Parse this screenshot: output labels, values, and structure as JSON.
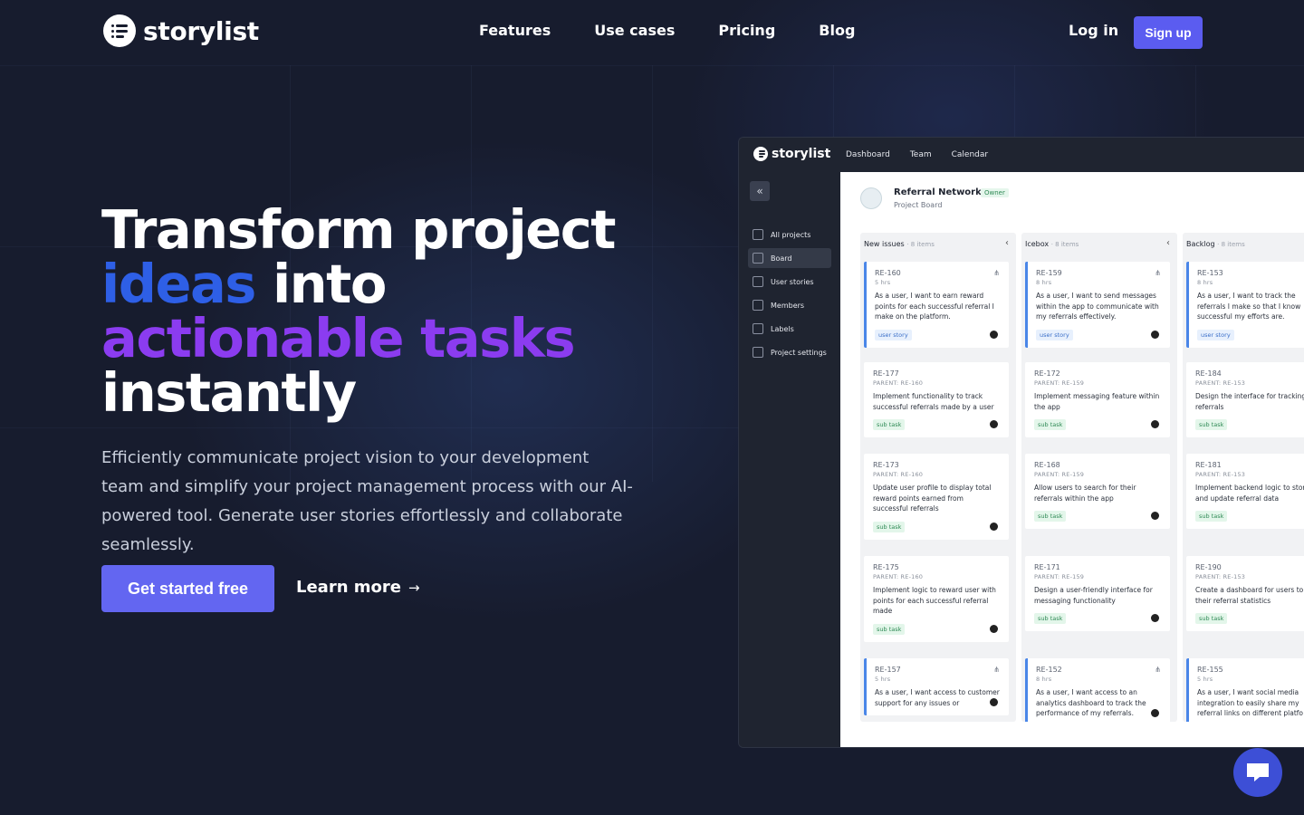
{
  "brand": {
    "name": "storylist"
  },
  "nav": {
    "links": [
      "Features",
      "Use cases",
      "Pricing",
      "Blog"
    ],
    "login": "Log in",
    "signup": "Sign up"
  },
  "hero": {
    "line1": "Transform project",
    "line2_highlight": "ideas",
    "line2_rest": " into",
    "line3": "actionable tasks",
    "line4": "instantly",
    "description": "Efficiently communicate project vision to your development team and simplify your project management process with our AI-powered tool. Generate user stories effortlessly and collaborate seamlessly.",
    "cta": "Get started free",
    "learn_more": "Learn more",
    "learn_arrow": "→"
  },
  "colors": {
    "accent": "#6366f1",
    "blue_text": "#2e5fe6",
    "purple_text": "#8b3cf0"
  },
  "app": {
    "logo": "storylist",
    "tabs": [
      "Dashboard",
      "Team",
      "Calendar"
    ],
    "sidebar": [
      "All projects",
      "Board",
      "User stories",
      "Members",
      "Labels",
      "Project settings"
    ],
    "sidebar_active": "Board",
    "project": {
      "title": "Referral Network",
      "badge": "Owner",
      "subtitle": "Project Board"
    },
    "columns": [
      {
        "name": "New issues",
        "count": "· 8 items",
        "cards": [
          {
            "id": "RE-160",
            "meta": "5 hrs",
            "text": "As a user, I want to earn reward points for each successful referral I make on the platform.",
            "tag": "user story",
            "type": "story"
          },
          {
            "id": "RE-177",
            "meta": "PARENT: RE-160",
            "text": "Implement functionality to track successful referrals made by a user",
            "tag": "sub task",
            "type": "sub"
          },
          {
            "id": "RE-173",
            "meta": "PARENT: RE-160",
            "text": "Update user profile to display total reward points earned from successful referrals",
            "tag": "sub task",
            "type": "sub"
          },
          {
            "id": "RE-175",
            "meta": "PARENT: RE-160",
            "text": "Implement logic to reward user with points for each successful referral made",
            "tag": "sub task",
            "type": "sub"
          },
          {
            "id": "RE-157",
            "meta": "5 hrs",
            "text": "As a user, I want access to customer support for any issues or",
            "tag": "",
            "type": "story"
          }
        ]
      },
      {
        "name": "Icebox",
        "count": "· 8 items",
        "cards": [
          {
            "id": "RE-159",
            "meta": "8 hrs",
            "text": "As a user, I want to send messages within the app to communicate with my referrals effectively.",
            "tag": "user story",
            "type": "story"
          },
          {
            "id": "RE-172",
            "meta": "PARENT: RE-159",
            "text": "Implement messaging feature within the app",
            "tag": "sub task",
            "type": "sub"
          },
          {
            "id": "RE-168",
            "meta": "PARENT: RE-159",
            "text": "Allow users to search for their referrals within the app",
            "tag": "sub task",
            "type": "sub"
          },
          {
            "id": "RE-171",
            "meta": "PARENT: RE-159",
            "text": "Design a user-friendly interface for messaging functionality",
            "tag": "sub task",
            "type": "sub"
          },
          {
            "id": "RE-152",
            "meta": "8 hrs",
            "text": "As a user, I want access to an analytics dashboard to track the performance of my referrals.",
            "tag": "",
            "type": "story"
          }
        ]
      },
      {
        "name": "Backlog",
        "count": "· 8 items",
        "cards": [
          {
            "id": "RE-153",
            "meta": "8 hrs",
            "text": "As a user, I want to track the referrals I make so that I know successful my efforts are.",
            "tag": "user story",
            "type": "story"
          },
          {
            "id": "RE-184",
            "meta": "PARENT: RE-153",
            "text": "Design the interface for tracking referrals",
            "tag": "sub task",
            "type": "sub"
          },
          {
            "id": "RE-181",
            "meta": "PARENT: RE-153",
            "text": "Implement backend logic to store and update referral data",
            "tag": "sub task",
            "type": "sub"
          },
          {
            "id": "RE-190",
            "meta": "PARENT: RE-153",
            "text": "Create a dashboard for users to view their referral statistics",
            "tag": "sub task",
            "type": "sub"
          },
          {
            "id": "RE-155",
            "meta": "5 hrs",
            "text": "As a user, I want social media integration to easily share my referral links on different platfo",
            "tag": "",
            "type": "story"
          }
        ]
      }
    ]
  }
}
